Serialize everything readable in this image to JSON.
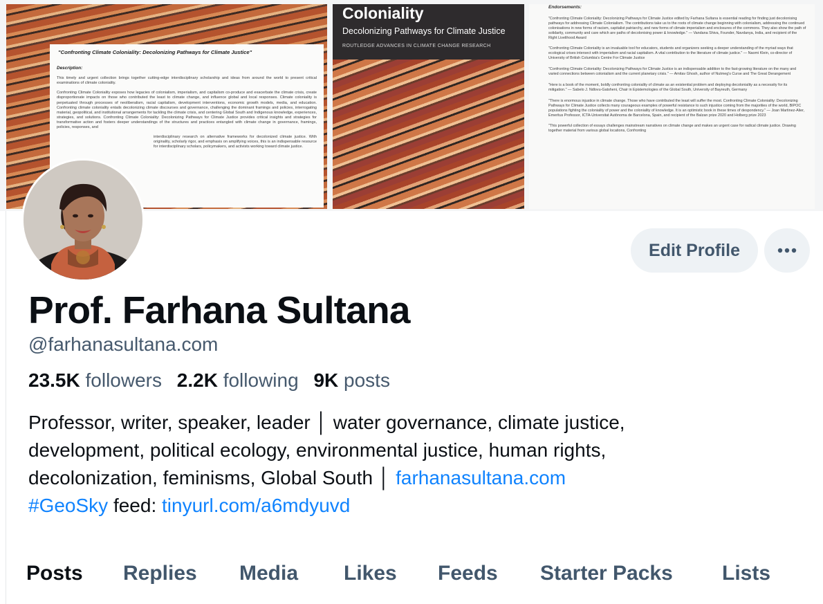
{
  "banner": {
    "description_card": {
      "title": "\"Confronting Climate Coloniality: Decolonizing Pathways for Climate Justice\"",
      "label": "Description:",
      "paragraphs": [
        "This timely and urgent collection brings together cutting-edge interdisciplinary scholarship and ideas from around the world to present critical examinations of climate coloniality.",
        "Confronting Climate Coloniality exposes how legacies of colonialism, imperialism, and capitalism co-produce and exacerbate the climate crisis, create disproportionate impacts on those who contributed the least to climate change, and influence global and local responses. Climate coloniality is perpetuated through processes of neoliberalism, racial capitalism, development interventions, economic growth models, media, and education. Confronting climate coloniality entails decolonizing climate discourses and governance, challenging the dominant framings and policies, interrogating material, geopolitical, and institutional arrangements for tackling the climate crisis, and centering Global South and Indigenous knowledge, experiences, strategies, and solutions. Confronting Climate Coloniality: Decolonizing Pathways for Climate Justice provides critical insights and strategies for transformative action and fosters deeper understandings of the structures and practices entangled with climate change in governance, framings, policies, responses, and",
        "interdisciplinary research on alternative frameworks for decolonized climate justice. With originality, scholarly rigor, and emphasis on amplifying voices, this is an indispensable resource for interdisciplinary scholars, policymakers, and activists working toward climate justice."
      ]
    },
    "book_cover": {
      "title": "Coloniality",
      "subtitle": "Decolonizing Pathways for Climate Justice",
      "series": "ROUTLEDGE ADVANCES IN CLIMATE CHANGE RESEARCH"
    },
    "endorsements": {
      "label": "Endorsements:",
      "items": [
        "\"Confronting Climate Coloniality: Decolonizing Pathways for Climate Justice edited by Farhana Sultana is essential reading for finding just decolonising pathways for addressing Climate Colonialism. The contributions take us to the roots of climate change beginning with colonialism, addressing the continued colonisations in new forms of racism, capitalist patriarchy, and new forms of climate imperialism and enclosures of the commons. They also show the path of solidarity, community and care which are paths of decolonising power & knowledge.\" — Vandana Shiva, Founder, Navdanya, India, and recipient of the Right Livelihood Award",
        "\"Confronting Climate Coloniality is an invaluable tool for educators, students and organizers seeking a deeper understanding of the myriad ways that ecological crises intersect with imperialism and racial capitalism. A vital contribution to the literature of climate justice.\" — Naomi Klein, co-director of University of British Columbia's Centre For Climate Justice",
        "\"Confronting Climate Coloniality: Decolonizing Pathways for Climate Justice is an indispensable addition to the fast-growing literature on the many and varied connections between colonialism and the current planetary crisis.\" — Amitav Ghosh, author of Nutmeg's Curse and The Great Derangement",
        "\"Here is a book of the moment, boldly confronting coloniality of climate as an existential problem and deploying decoloniality as a necessity for its mitigation.\" — Sabelo J. Ndlovu-Gatsheni, Chair in Epistemologies of the Global South, University of Bayreuth, Germany",
        "\"There is enormous injustice in climate change. Those who have contributed the least will suffer the most. Confronting Climate Coloniality: Decolonizing Pathways for Climate Justice collects many courageous examples of powerful resistance to such injustice coming from the majorities of the world, BIPOC populations fighting the coloniality of power and the coloniality of knowledge. It is an optimistic book in these times of despondency.\" — Joan Martinez-Alier, Emeritus Professor, ICTA-Universitat Autònoma de Barcelona, Spain, and recipient of the Balzan prize 2020 and Holberg prize 2023",
        "\"This powerful collection of essays challenges mainstream narratives on climate change and makes an urgent case for radical climate justice. Drawing together material from various global locations, Confronting"
      ]
    }
  },
  "profile": {
    "name": "Prof. Farhana Sultana",
    "handle": "@farhanasultana.com",
    "followers_count": "23.5K",
    "followers_label": "followers",
    "following_count": "2.2K",
    "following_label": "following",
    "posts_count": "9K",
    "posts_label": "posts",
    "bio_line1": "Professor, writer, speaker, leader │ water governance, climate justice,",
    "bio_line2": "development, political ecology, environmental justice, human rights,",
    "bio_line3_text": "decolonization, feminisms, Global South │ ",
    "bio_line3_link": "farhanasultana.com",
    "bio_line4_tag": "#GeoSky",
    "bio_line4_text": " feed: ",
    "bio_line4_link": "tinyurl.com/a6mdyuvd"
  },
  "actions": {
    "edit_label": "Edit Profile",
    "more_icon": "ellipsis-icon"
  },
  "tabs": [
    "Posts",
    "Replies",
    "Media",
    "Likes",
    "Feeds",
    "Starter Packs",
    "Lists"
  ],
  "colors": {
    "link": "#1083fe",
    "secondary_text": "#46596d",
    "button_bg": "#eef2f5",
    "text": "#0b0f14"
  }
}
